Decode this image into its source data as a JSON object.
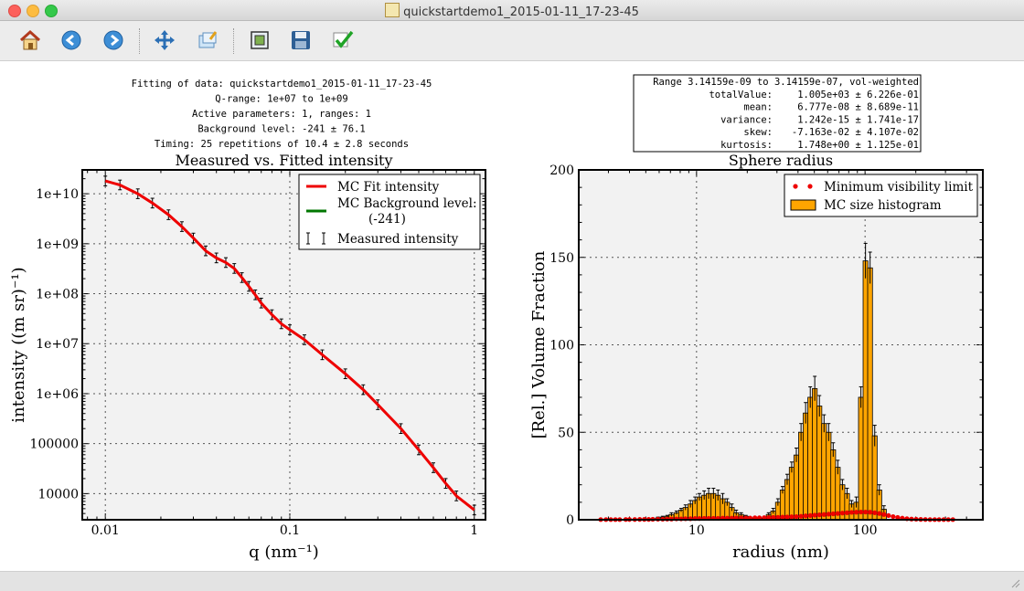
{
  "window": {
    "title": "quickstartdemo1_2015-01-11_17-23-45"
  },
  "toolbar": {
    "icons": [
      "home-icon",
      "back-icon",
      "forward-icon",
      "pan-icon",
      "configure-subplots-icon",
      "zoom-icon",
      "save-icon",
      "check-icon"
    ]
  },
  "info": {
    "lines": [
      "Fitting of data: quickstartdemo1_2015-01-11_17-23-45",
      "Q-range: 1e+07 to 1e+09",
      "Active parameters: 1, ranges: 1",
      "Background level: -241 ± 76.1",
      "Timing: 25 repetitions of 10.4 ± 2.8 seconds"
    ]
  },
  "stats": {
    "header": "Range 3.14159e-09 to 3.14159e-07, vol-weighted",
    "rows": [
      {
        "label": "totalValue:",
        "value": "1.005e+03 ± 6.226e-01"
      },
      {
        "label": "mean:",
        "value": "6.777e-08 ± 8.689e-11"
      },
      {
        "label": "variance:",
        "value": "1.242e-15 ± 1.741e-17"
      },
      {
        "label": "skew:",
        "value": "-7.163e-02 ± 4.107e-02"
      },
      {
        "label": "kurtosis:",
        "value": "1.748e+00 ± 1.125e-01"
      }
    ]
  },
  "colors": {
    "fit": "#ee0000",
    "background": "#007700",
    "data": "#000000",
    "bar": "#ffa500",
    "minvis": "#ee0000",
    "axesbg": "#f2f2f2"
  },
  "chart_data": [
    {
      "type": "line",
      "title": "Measured vs. Fitted intensity",
      "xlabel": "q (nm⁻¹)",
      "ylabel": "intensity ((m sr)⁻¹)",
      "xscale": "log",
      "yscale": "log",
      "xlim": [
        0.0075,
        1.15
      ],
      "ylim": [
        3000,
        30000000000
      ],
      "xticks": [
        {
          "v": 0.01,
          "label": "0.01"
        },
        {
          "v": 0.1,
          "label": "0.1"
        },
        {
          "v": 1,
          "label": "1"
        }
      ],
      "yticks": [
        {
          "v": 10000,
          "label": "10000"
        },
        {
          "v": 100000,
          "label": "100000"
        },
        {
          "v": 1000000,
          "label": "1e+06"
        },
        {
          "v": 10000000,
          "label": "1e+07"
        },
        {
          "v": 100000000,
          "label": "1e+08"
        },
        {
          "v": 1000000000,
          "label": "1e+09"
        },
        {
          "v": 10000000000,
          "label": "1e+10"
        }
      ],
      "grid": true,
      "legend_position": "top-right",
      "series": [
        {
          "name": "MC Fit intensity",
          "style": "line",
          "x": [
            0.01,
            0.012,
            0.015,
            0.018,
            0.022,
            0.026,
            0.03,
            0.035,
            0.04,
            0.045,
            0.05,
            0.055,
            0.06,
            0.065,
            0.07,
            0.08,
            0.09,
            0.1,
            0.12,
            0.15,
            0.2,
            0.25,
            0.3,
            0.4,
            0.5,
            0.6,
            0.7,
            0.8,
            1.0
          ],
          "y": [
            18000000000,
            15000000000,
            10000000000,
            6500000000,
            3800000000,
            2200000000,
            1300000000,
            720000000,
            520000000,
            420000000,
            320000000,
            210000000,
            140000000,
            95000000,
            65000000,
            38000000,
            25000000,
            19000000,
            12000000,
            6000000,
            2500000,
            1200000,
            600000,
            200000,
            75000,
            33000,
            16000,
            9000,
            4700
          ]
        },
        {
          "name": "MC Background level:",
          "name_line2": "(-241)",
          "style": "line",
          "x": [],
          "y": []
        },
        {
          "name": "Measured intensity",
          "style": "errorbar",
          "x": [
            0.01,
            0.012,
            0.015,
            0.018,
            0.022,
            0.026,
            0.03,
            0.035,
            0.04,
            0.045,
            0.05,
            0.055,
            0.06,
            0.065,
            0.07,
            0.08,
            0.09,
            0.1,
            0.12,
            0.15,
            0.2,
            0.25,
            0.3,
            0.4,
            0.5,
            0.6,
            0.7,
            0.8,
            1.0
          ],
          "y": [
            18000000000,
            15000000000,
            10000000000,
            6500000000,
            3800000000,
            2200000000,
            1300000000,
            720000000,
            520000000,
            420000000,
            320000000,
            210000000,
            140000000,
            95000000,
            65000000,
            38000000,
            25000000,
            19000000,
            12000000,
            6000000,
            2500000,
            1200000,
            600000,
            200000,
            75000,
            33000,
            16000,
            9000,
            4700
          ]
        }
      ]
    },
    {
      "type": "bar",
      "title": "Sphere radius",
      "xlabel": "radius (nm)",
      "ylabel": "[Rel.] Volume Fraction",
      "xscale": "log",
      "xlim": [
        2.0,
        500
      ],
      "ylim": [
        0,
        200
      ],
      "xticks": [
        {
          "v": 10,
          "label": "10"
        },
        {
          "v": 100,
          "label": "100"
        }
      ],
      "yticks": [
        {
          "v": 0,
          "label": "0"
        },
        {
          "v": 50,
          "label": "50"
        },
        {
          "v": 100,
          "label": "100"
        },
        {
          "v": 150,
          "label": "150"
        },
        {
          "v": 200,
          "label": "200"
        }
      ],
      "grid": true,
      "legend_position": "top-right",
      "series": [
        {
          "name": "MC size histogram",
          "style": "bar",
          "x": [
            5.9,
            6.3,
            6.7,
            7.1,
            7.6,
            8.1,
            8.6,
            9.2,
            9.8,
            10.4,
            11.1,
            11.8,
            12.6,
            13.4,
            14.3,
            15.2,
            16.2,
            17.2,
            18.4,
            19.6,
            20.8,
            22.2,
            23.6,
            25.2,
            26.8,
            28.5,
            30.4,
            32.4,
            34.5,
            36.7,
            39.1,
            41.7,
            44.4,
            47.3,
            50.3,
            53.6,
            57.1,
            60.8,
            64.7,
            68.9,
            73.4,
            78.2,
            83.3,
            88.7,
            94.5,
            100.6,
            107.1,
            114.1,
            121.5,
            129.4
          ],
          "y": [
            1,
            1.5,
            2,
            3,
            4,
            5.5,
            7,
            9,
            11,
            13,
            14,
            15,
            15,
            14,
            12,
            10,
            7,
            4,
            3,
            2,
            1,
            0.5,
            0.5,
            1,
            3,
            5,
            10,
            17,
            23,
            30,
            37,
            50,
            61,
            70,
            75,
            65,
            55,
            50,
            40,
            30,
            20,
            15,
            9,
            10,
            70,
            148,
            144,
            48,
            17,
            6
          ],
          "err": [
            0.5,
            0.5,
            0.5,
            1,
            1,
            1,
            1.5,
            2,
            2,
            2,
            2.5,
            3,
            3,
            3,
            3,
            2,
            2,
            1.5,
            1,
            0.5,
            0.5,
            0.5,
            0.5,
            0.5,
            1,
            1.5,
            2,
            2,
            3,
            3,
            4,
            5,
            6,
            6,
            7,
            6,
            5,
            5,
            4,
            4,
            3,
            3,
            2,
            3,
            6,
            10,
            9,
            6,
            3,
            2
          ]
        },
        {
          "name": "Minimum visibility limit",
          "style": "dots",
          "x": [
            2.7,
            2.9,
            3.1,
            3.3,
            3.5,
            3.8,
            4.0,
            4.3,
            4.6,
            4.9,
            5.2,
            5.5,
            5.9,
            6.3,
            6.7,
            7.1,
            7.6,
            8.1,
            8.6,
            9.2,
            9.8,
            10.4,
            11.1,
            11.8,
            12.6,
            13.4,
            14.3,
            15.2,
            16.2,
            17.2,
            18.4,
            19.6,
            20.8,
            22.2,
            23.6,
            25.2,
            26.8,
            28.5,
            30.4,
            32.4,
            34.5,
            36.7,
            39.1,
            41.7,
            44.4,
            47.3,
            50.3,
            53.6,
            57.1,
            60.8,
            64.7,
            68.9,
            73.4,
            78.2,
            83.3,
            88.7,
            94.5,
            100.6,
            107.1,
            114.1,
            121.5,
            129.4,
            137.8,
            146.7,
            156.2,
            166.4,
            177.2,
            188.7,
            201,
            214,
            228,
            243,
            259,
            275,
            293,
            312,
            332
          ],
          "y": [
            0.1,
            0.1,
            0.1,
            0.1,
            0.1,
            0.15,
            0.15,
            0.15,
            0.2,
            0.2,
            0.2,
            0.25,
            0.3,
            0.3,
            0.35,
            0.4,
            0.5,
            0.5,
            0.6,
            0.6,
            0.7,
            0.7,
            0.8,
            0.8,
            0.8,
            0.8,
            0.9,
            0.9,
            0.9,
            1.0,
            1.0,
            1.0,
            1.0,
            1.1,
            1.1,
            1.2,
            1.2,
            1.3,
            1.4,
            1.5,
            1.6,
            1.7,
            1.8,
            2.0,
            2.2,
            2.4,
            2.6,
            2.8,
            3.0,
            3.2,
            3.4,
            3.6,
            3.8,
            4.0,
            4.2,
            4.3,
            4.4,
            4.4,
            4.3,
            4.0,
            3.6,
            3.0,
            2.4,
            1.8,
            1.3,
            0.9,
            0.6,
            0.4,
            0.3,
            0.2,
            0.15,
            0.1,
            0.1,
            0.1,
            0.1,
            0.1,
            0.1
          ]
        }
      ]
    }
  ]
}
